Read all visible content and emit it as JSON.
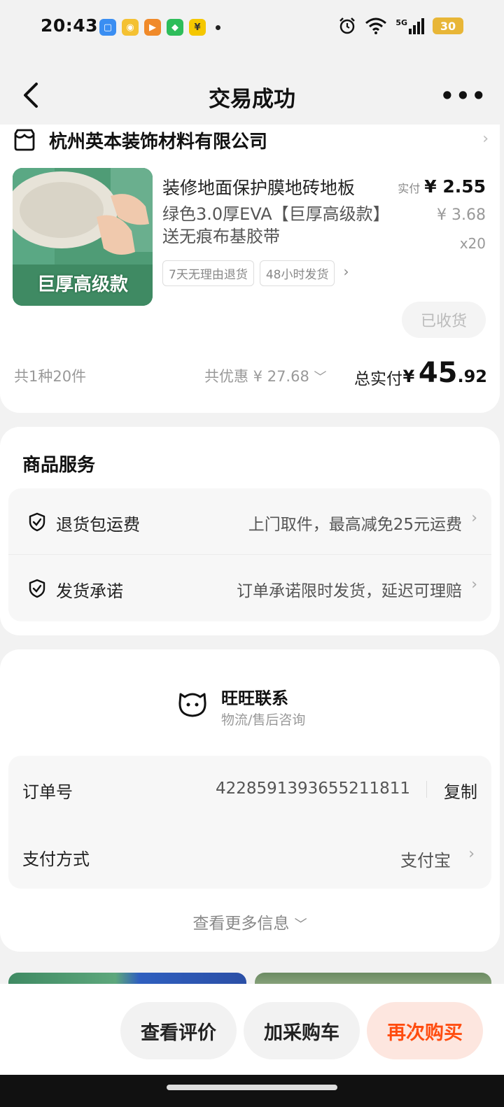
{
  "status_bar": {
    "time": "20:43",
    "network": "5G",
    "battery": "30",
    "app_icons": [
      "files-icon",
      "weibo-icon",
      "video-icon",
      "wechat-icon",
      "payment-icon"
    ],
    "app_icon_colors": [
      "#3a8ef2",
      "#f4c132",
      "#f08a2a",
      "#2ebd5a",
      "#f5c700"
    ]
  },
  "nav": {
    "title": "交易成功",
    "back_icon": "back-arrow-icon",
    "more_icon": "more-dots-icon",
    "more_label": "•••"
  },
  "order": {
    "store_name": "杭州英本装饰材料有限公司",
    "product": {
      "title": "装修地面保护膜地砖地板",
      "subtitle": "绿色3.0厚EVA【巨厚高级款】送无痕布基胶带",
      "image_caption": "巨厚高级款",
      "tags": [
        "7天无理由退货",
        "48小时发货"
      ],
      "paid_label": "实付",
      "paid_price": "¥ 2.55",
      "original_price": "¥ 3.68",
      "quantity": "x20",
      "status_button": "已收货"
    },
    "summary": {
      "count": "共1种20件",
      "discount": "共优惠 ¥ 27.68",
      "total_label": "总实付",
      "total_currency": "¥",
      "total_int": "45",
      "total_dec": ".92"
    }
  },
  "services": {
    "title": "商品服务",
    "items": [
      {
        "name": "退货包运费",
        "desc": "上门取件，最高减免25元运费"
      },
      {
        "name": "发货承诺",
        "desc": "订单承诺限时发货，延迟可理赔"
      }
    ]
  },
  "contact": {
    "title": "旺旺联系",
    "subtitle": "物流/售后咨询"
  },
  "info": {
    "order_no_label": "订单号",
    "order_no": "4228591393655211811",
    "copy_label": "复制",
    "payment_label": "支付方式",
    "payment_value": "支付宝",
    "more_info": "查看更多信息"
  },
  "actions": {
    "review": "查看评价",
    "cart": "加采购车",
    "rebuy": "再次购买"
  },
  "colors": {
    "accent": "#ff4c0f",
    "accent_bg": "#fde6df"
  }
}
